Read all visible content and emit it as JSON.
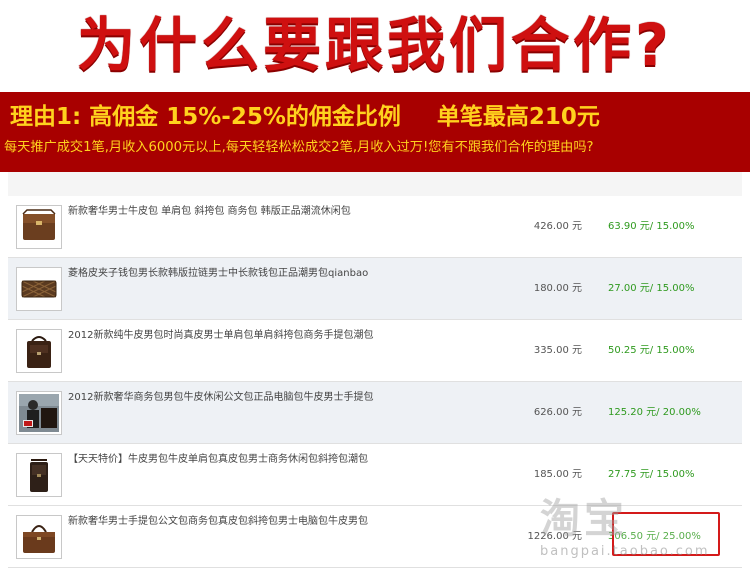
{
  "headline": {
    "title": "为什么要跟我们合作?"
  },
  "banner": {
    "reason_prefix": "理由1:",
    "reason_main": "高佣金 15%-25%的佣金比例",
    "reason_max": "单笔最高210元",
    "subline": "每天推广成交1笔,月收入6000元以上,每天轻轻松松成交2笔,月收入过万!您有不跟我们合作的理由吗?"
  },
  "products": [
    {
      "name": "新款奢华男士牛皮包 单肩包 斜挎包 商务包 韩版正品潮流休闲包",
      "price": "426.00 元",
      "commission": "63.90 元/",
      "rate": "15.00%",
      "thumb_icon": "messenger-bag-icon"
    },
    {
      "name": "菱格皮夹子钱包男长款韩版拉链男士中长款钱包正品潮男包qianbao",
      "price": "180.00 元",
      "commission": "27.00 元/",
      "rate": "15.00%",
      "thumb_icon": "wallet-icon"
    },
    {
      "name": "2012新款纯牛皮男包时尚真皮男士单肩包单肩斜挎包商务手提包潮包",
      "price": "335.00 元",
      "commission": "50.25 元/",
      "rate": "15.00%",
      "thumb_icon": "shoulder-bag-icon"
    },
    {
      "name": "2012新款奢华商务包男包牛皮休闲公文包正品电脑包牛皮男士手提包",
      "price": "626.00 元",
      "commission": "125.20 元/",
      "rate": "20.00%",
      "thumb_icon": "briefcase-photo-icon"
    },
    {
      "name": "【天天特价】牛皮男包牛皮单肩包真皮包男士商务休闲包斜挎包潮包",
      "price": "185.00 元",
      "commission": "27.75 元/",
      "rate": "15.00%",
      "thumb_icon": "crossbody-bag-icon"
    },
    {
      "name": "新款奢华男士手提包公文包商务包真皮包斜挎包男士电脑包牛皮男包",
      "price": "1226.00 元",
      "commission": "306.50 元/",
      "rate": "25.00%",
      "thumb_icon": "handbag-icon"
    }
  ],
  "watermark": {
    "main": "淘宝",
    "url": "bangpai.taobao.com"
  },
  "colors": {
    "headline_red": "#cf1010",
    "banner_red": "#a80000",
    "banner_text": "#ffd21e",
    "commission_green": "#2f9a1f",
    "stamp_red": "#d41a1a"
  }
}
